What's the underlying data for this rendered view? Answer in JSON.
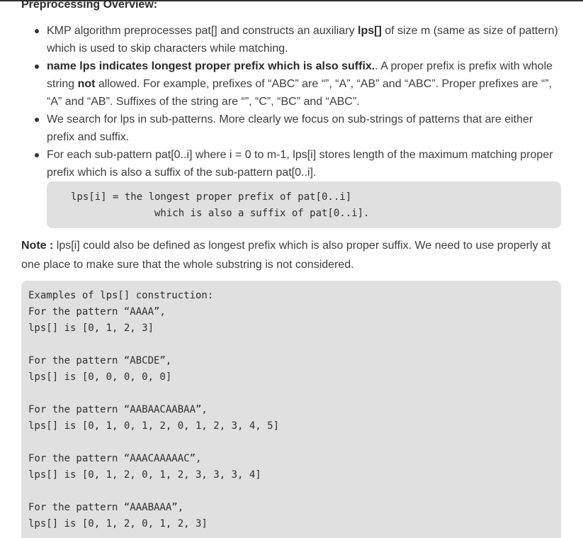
{
  "heading": "Preprocessing Overview:",
  "bullets": [
    {
      "text": "KMP algorithm preprocesses pat[] and constructs an auxiliary ",
      "bold": "lps[]",
      "rest": " of size m (same as size of pattern) which is used to skip characters while matching."
    },
    {
      "bold": "name lps indicates longest proper prefix which is also suffix.",
      "text": ". A proper prefix is prefix with whole string ",
      "bold2": "not",
      "rest": " allowed. For example, prefixes of “ABC” are “”, “A”, “AB” and “ABC”. Proper prefixes are “”, “A” and “AB”. Suffixes of the string are “”, “C”, “BC” and “ABC”."
    },
    {
      "text": "We search for lps in sub-patterns. More clearly we focus on sub-strings of patterns that are either prefix and suffix."
    },
    {
      "text": "For each sub-pattern pat[0..i] where i = 0 to m-1, lps[i] stores length of the maximum matching proper prefix which is also a suffix of the sub-pattern pat[0..i]."
    }
  ],
  "definition_code": "lps[i] = the longest proper prefix of pat[0..i]\n              which is also a suffix of pat[0..i].",
  "note": {
    "label": "Note :",
    "text": " lps[i] could also be defined as longest prefix which is also proper suffix. We need to use properly at one place to make sure that the whole substring is not considered."
  },
  "examples_code": "Examples of lps[] construction:\nFor the pattern “AAAA”,\nlps[] is [0, 1, 2, 3]\n\nFor the pattern “ABCDE”,\nlps[] is [0, 0, 0, 0, 0]\n\nFor the pattern “AABAACAABAA”,\nlps[] is [0, 1, 0, 1, 2, 0, 1, 2, 3, 4, 5]\n\nFor the pattern “AAACAAAAAC”,\nlps[] is [0, 1, 2, 0, 1, 2, 3, 3, 3, 4]\n\nFor the pattern “AAABAAA”,\nlps[] is [0, 1, 2, 0, 1, 2, 3]"
}
